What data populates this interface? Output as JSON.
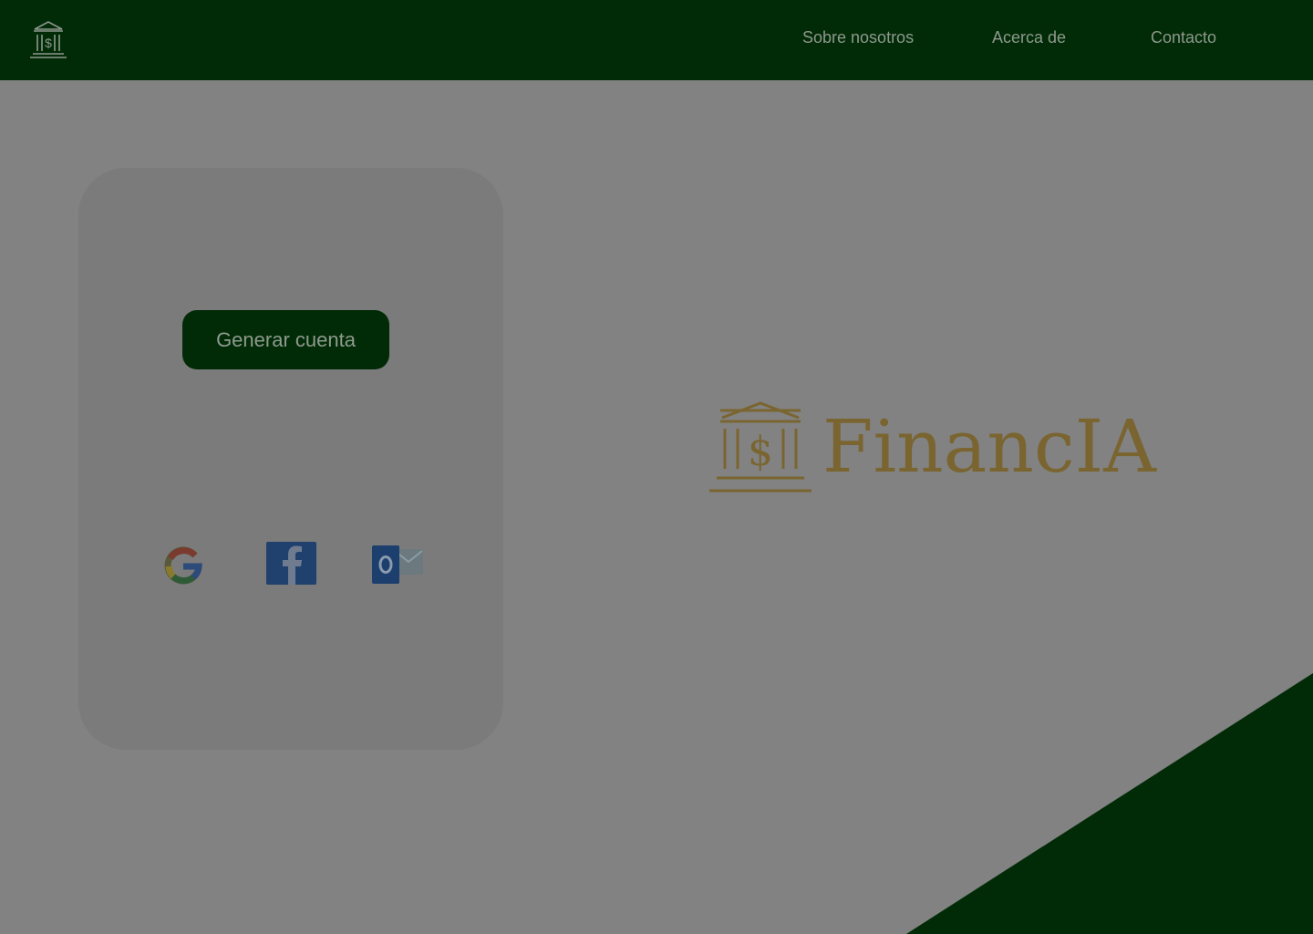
{
  "colors": {
    "dark_green": "#012b06",
    "background": "#828282",
    "card": "#7b7b7b",
    "gold": "#7a6530"
  },
  "header": {
    "logo_icon": "bank-icon",
    "nav": [
      {
        "label": "Sobre nosotros"
      },
      {
        "label": "Acerca de"
      },
      {
        "label": "Contacto"
      }
    ]
  },
  "signup_card": {
    "create_account_label": "Generar cuenta",
    "social_providers": [
      {
        "name": "google-icon"
      },
      {
        "name": "facebook-icon"
      },
      {
        "name": "outlook-icon"
      }
    ]
  },
  "brand": {
    "emblem_icon": "bank-dollar-icon",
    "name": "FinancIA"
  }
}
